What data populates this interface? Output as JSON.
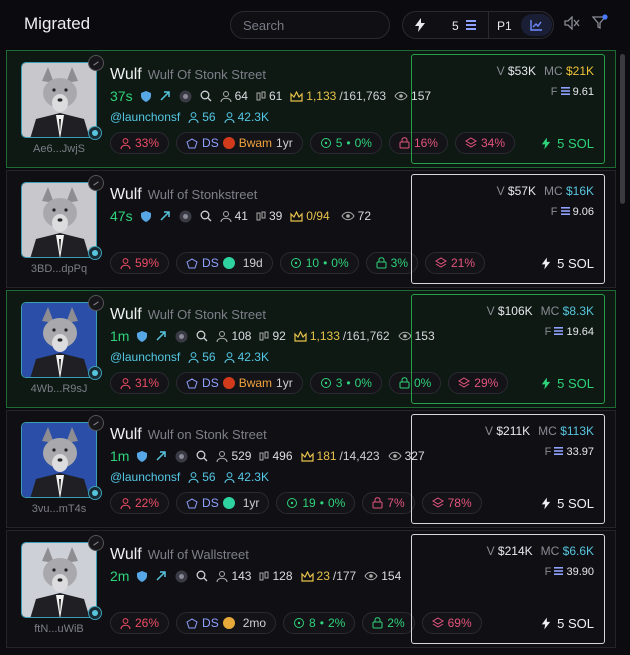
{
  "header": {
    "title": "Migrated",
    "search_placeholder": "Search",
    "amount": "5",
    "preset": "P1"
  },
  "colors": {
    "accent": "#2fd37a",
    "highlight_border": "#26a046",
    "cyan": "#57c5de",
    "mc_yellow": "#f0c238"
  },
  "cards": [
    {
      "symbol": "Wulf",
      "name": "Wulf Of Stonk Street",
      "age": "37s",
      "addr": "Ae6...JwjS",
      "holders": "64",
      "pro": "61",
      "dev_label": "1,133",
      "dev_total": "/161,763",
      "views": "157",
      "twitter": "@launchonsf",
      "followers": "56",
      "following": "42.3K",
      "top10": "33%",
      "ds": "DS",
      "tag": "Bwam",
      "tag_age": "1yr",
      "snipers": "5",
      "snipe_pct": "0%",
      "insiders": "16%",
      "bundles": "34%",
      "volume": "$53K",
      "mc": "$21K",
      "fee": "9.61",
      "buy": "5 SOL",
      "highlight": true
    },
    {
      "symbol": "Wulf",
      "name": "Wulf of Stonkstreet",
      "age": "47s",
      "addr": "3BD...dpPq",
      "holders": "41",
      "pro": "39",
      "dev_label": "0/94",
      "dev_total": "",
      "views": "72",
      "twitter": "",
      "followers": "",
      "following": "",
      "top10": "59%",
      "ds": "DS",
      "tag": "",
      "tag_age": "19d",
      "snipers": "10",
      "snipe_pct": "0%",
      "insiders": "3%",
      "bundles": "21%",
      "volume": "$57K",
      "mc": "$16K",
      "fee": "9.06",
      "buy": "5 SOL",
      "highlight": false
    },
    {
      "symbol": "Wulf",
      "name": "Wulf Of Stonk Street",
      "age": "1m",
      "addr": "4Wb...R9sJ",
      "holders": "108",
      "pro": "92",
      "dev_label": "1,133",
      "dev_total": "/161,762",
      "views": "153",
      "twitter": "@launchonsf",
      "followers": "56",
      "following": "42.3K",
      "top10": "31%",
      "ds": "DS",
      "tag": "Bwam",
      "tag_age": "1yr",
      "snipers": "3",
      "snipe_pct": "0%",
      "insiders": "0%",
      "bundles": "29%",
      "volume": "$106K",
      "mc": "$8.3K",
      "fee": "19.64",
      "buy": "5 SOL",
      "highlight": true
    },
    {
      "symbol": "Wulf",
      "name": "Wulf on Stonk Street",
      "age": "1m",
      "addr": "3vu...mT4s",
      "holders": "529",
      "pro": "496",
      "dev_label": "181",
      "dev_total": "/14,423",
      "views": "327",
      "twitter": "@launchonsf",
      "followers": "56",
      "following": "42.3K",
      "top10": "22%",
      "ds": "DS",
      "tag": "",
      "tag_age": "1yr",
      "snipers": "19",
      "snipe_pct": "0%",
      "insiders": "7%",
      "bundles": "78%",
      "volume": "$211K",
      "mc": "$113K",
      "fee": "33.97",
      "buy": "5 SOL",
      "highlight": false
    },
    {
      "symbol": "Wulf",
      "name": "Wulf of Wallstreet",
      "age": "2m",
      "addr": "ftN...uWiB",
      "holders": "143",
      "pro": "128",
      "dev_label": "23",
      "dev_total": "/177",
      "views": "154",
      "twitter": "",
      "followers": "",
      "following": "",
      "top10": "26%",
      "ds": "DS",
      "tag": "",
      "tag_age": "2mo",
      "snipers": "8",
      "snipe_pct": "2%",
      "insiders": "2%",
      "bundles": "69%",
      "volume": "$214K",
      "mc": "$6.6K",
      "fee": "39.90",
      "buy": "5 SOL",
      "highlight": false
    }
  ]
}
